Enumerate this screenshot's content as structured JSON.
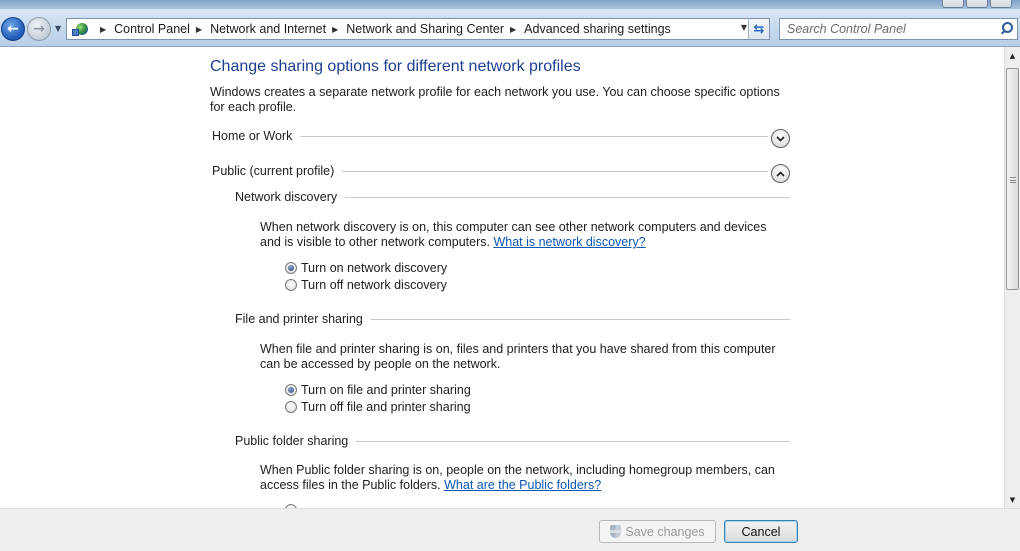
{
  "nav": {
    "breadcrumbs": [
      "Control Panel",
      "Network and Internet",
      "Network and Sharing Center",
      "Advanced sharing settings"
    ],
    "search_placeholder": "Search Control Panel"
  },
  "main": {
    "title": "Change sharing options for different network profiles",
    "description": "Windows creates a separate network profile for each network you use. You can choose specific options for each profile.",
    "profiles": [
      {
        "label": "Home or Work",
        "expanded": false
      },
      {
        "label": "Public (current profile)",
        "expanded": true
      }
    ],
    "sections": {
      "network_discovery": {
        "heading": "Network discovery",
        "text": "When network discovery is on, this computer can see other network computers and devices and is visible to other network computers.",
        "link": "What is network discovery?",
        "options": [
          "Turn on network discovery",
          "Turn off network discovery"
        ],
        "selected": 0
      },
      "file_printer": {
        "heading": "File and printer sharing",
        "text": "When file and printer sharing is on, files and printers that you have shared from this computer can be accessed by people on the network.",
        "options": [
          "Turn on file and printer sharing",
          "Turn off file and printer sharing"
        ],
        "selected": 0
      },
      "public_folder": {
        "heading": "Public folder sharing",
        "text": "When Public folder sharing is on, people on the network, including homegroup members, can access files in the Public folders.",
        "link": "What are the Public folders?"
      }
    }
  },
  "footer": {
    "save_label": "Save changes",
    "cancel_label": "Cancel"
  },
  "colors": {
    "title": "#1e3f8f",
    "link": "#0a56b3",
    "nav_gradient_top": "#d9e6f4"
  }
}
